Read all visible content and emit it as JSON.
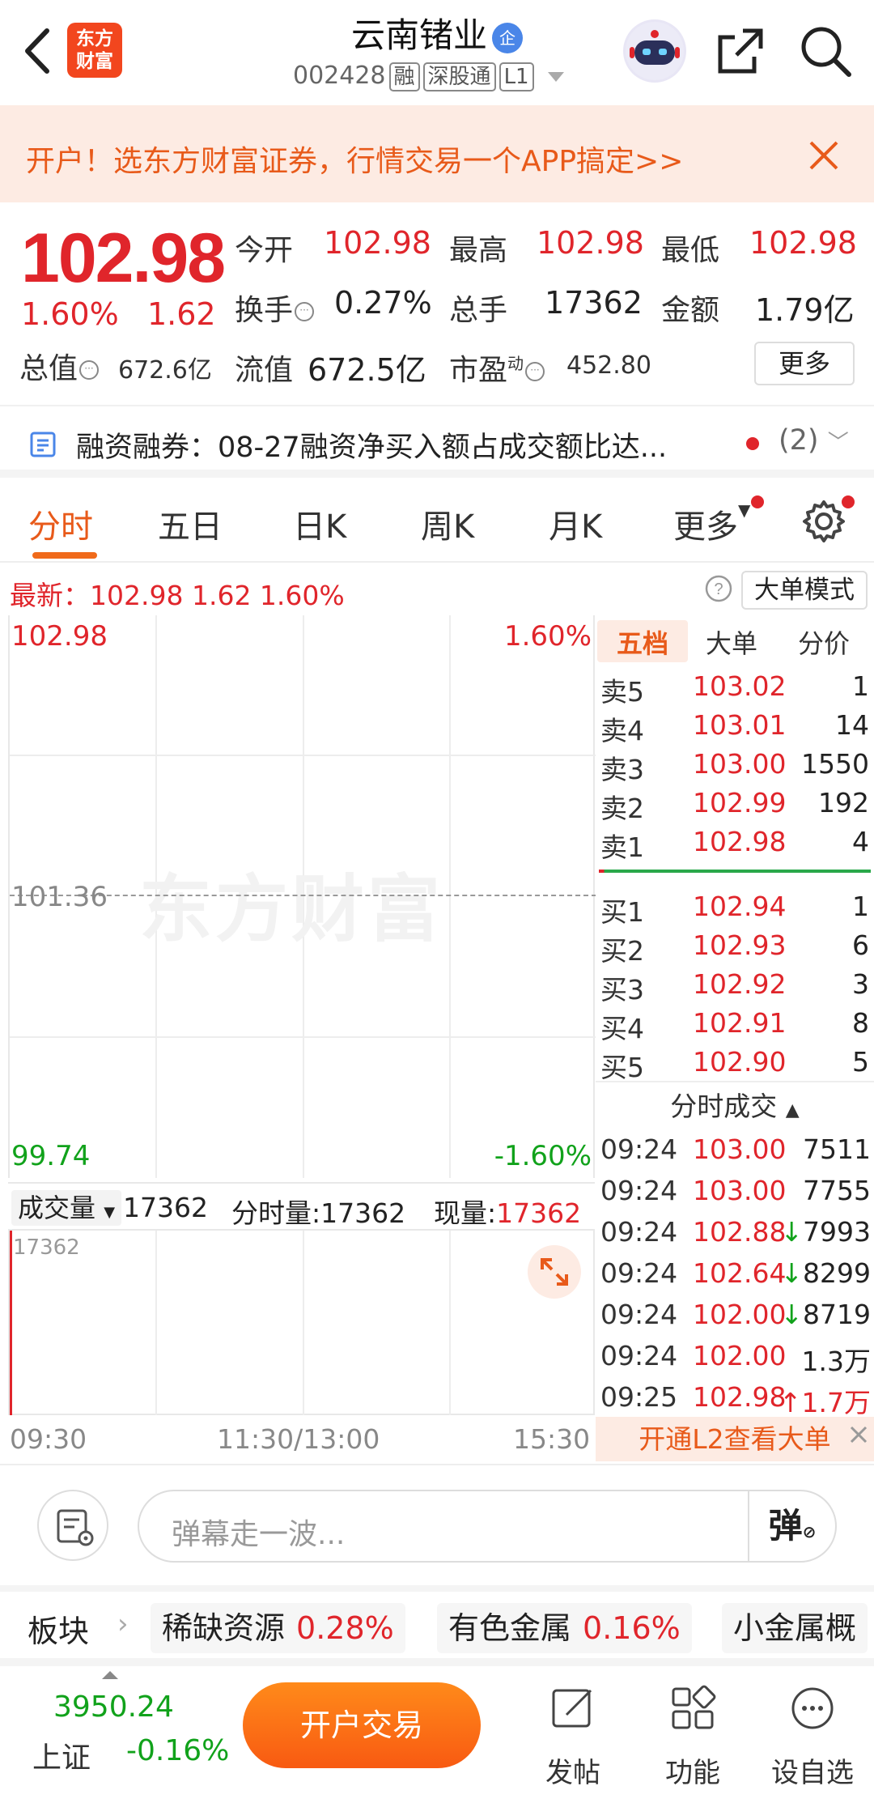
{
  "header": {
    "logo_line1": "东方",
    "logo_line2": "财富",
    "stock_name": "云南锗业",
    "qi_badge": "企",
    "stock_code": "002428",
    "tag_rong": "融",
    "tag_connect": "深股通",
    "tag_level": "L1"
  },
  "promo": {
    "text": "开户！选东方财富证券，行情交易一个APP搞定>>"
  },
  "quote": {
    "price": "102.98",
    "change_pct": "1.60%",
    "change": "1.62",
    "open_label": "今开",
    "open": "102.98",
    "high_label": "最高",
    "high": "102.98",
    "low_label": "最低",
    "low": "102.98",
    "turnover_label": "换手",
    "turnover": "0.27%",
    "volume_label": "总手",
    "volume": "17362",
    "amount_label": "金额",
    "amount": "1.79亿",
    "mktcap_label": "总值",
    "mktcap": "672.6亿",
    "float_label": "流值",
    "float": "672.5亿",
    "pe_label": "市盈",
    "pe_sup": "动",
    "pe": "452.80",
    "more_label": "更多"
  },
  "margin": {
    "text": "融资融券：08-27融资净买入额占成交额比达...",
    "count": "(2)"
  },
  "tabs": [
    "分时",
    "五日",
    "日K",
    "周K",
    "月K",
    "更多"
  ],
  "latest": {
    "text": "最新：102.98  1.62  1.60%",
    "big_order_mode": "大单模式"
  },
  "chart": {
    "top_price": "102.98",
    "top_pct": "1.60%",
    "mid_price": "101.36",
    "low_price": "99.74",
    "low_pct": "-1.60%",
    "watermark": "东方财富"
  },
  "volume": {
    "dropdown": "成交量",
    "total": "17362",
    "minute_vol": "分时量:17362",
    "now_label": "现量:",
    "now_value": "17362",
    "max": "17362"
  },
  "time_axis": [
    "09:30",
    "11:30/13:00",
    "15:30"
  ],
  "orderbook": {
    "tabs": [
      "五档",
      "大单",
      "分价"
    ],
    "asks": [
      {
        "label": "卖5",
        "price": "103.02",
        "vol": "1"
      },
      {
        "label": "卖4",
        "price": "103.01",
        "vol": "14"
      },
      {
        "label": "卖3",
        "price": "103.00",
        "vol": "1550"
      },
      {
        "label": "卖2",
        "price": "102.99",
        "vol": "192"
      },
      {
        "label": "卖1",
        "price": "102.98",
        "vol": "4"
      }
    ],
    "bids": [
      {
        "label": "买1",
        "price": "102.94",
        "vol": "1"
      },
      {
        "label": "买2",
        "price": "102.93",
        "vol": "6"
      },
      {
        "label": "买3",
        "price": "102.92",
        "vol": "3"
      },
      {
        "label": "买4",
        "price": "102.91",
        "vol": "8"
      },
      {
        "label": "买5",
        "price": "102.90",
        "vol": "5"
      }
    ],
    "ticks_header": "分时成交",
    "ticks": [
      {
        "time": "09:24",
        "price": "103.00",
        "vol": "7511"
      },
      {
        "time": "09:24",
        "price": "103.00",
        "vol": "7755"
      },
      {
        "time": "09:24",
        "price": "102.88",
        "vol": "↓7993"
      },
      {
        "time": "09:24",
        "price": "102.64",
        "vol": "↓8299"
      },
      {
        "time": "09:24",
        "price": "102.00",
        "vol": "↓8719"
      },
      {
        "time": "09:24",
        "price": "102.00",
        "vol": "1.3万"
      },
      {
        "time": "09:25",
        "price": "102.98",
        "vol": "↑1.7万"
      }
    ],
    "l2_banner": "开通L2查看大单"
  },
  "comment": {
    "placeholder": "弹幕走一波...",
    "danmu_label": "弹"
  },
  "sectors": {
    "label": "板块",
    "items": [
      {
        "name": "稀缺资源",
        "pct": "0.28%"
      },
      {
        "name": "有色金属",
        "pct": "0.16%"
      },
      {
        "name": "小金属概",
        "pct": ""
      }
    ]
  },
  "bottom": {
    "index_value": "3950.24",
    "index_name": "上证",
    "index_pct": "-0.16%",
    "trade_button": "开户交易",
    "post": "发帖",
    "func": "功能",
    "watchlist": "设自选"
  },
  "colors": {
    "up": "#e0252b",
    "down": "#11a21b",
    "accent": "#f06a1a"
  }
}
